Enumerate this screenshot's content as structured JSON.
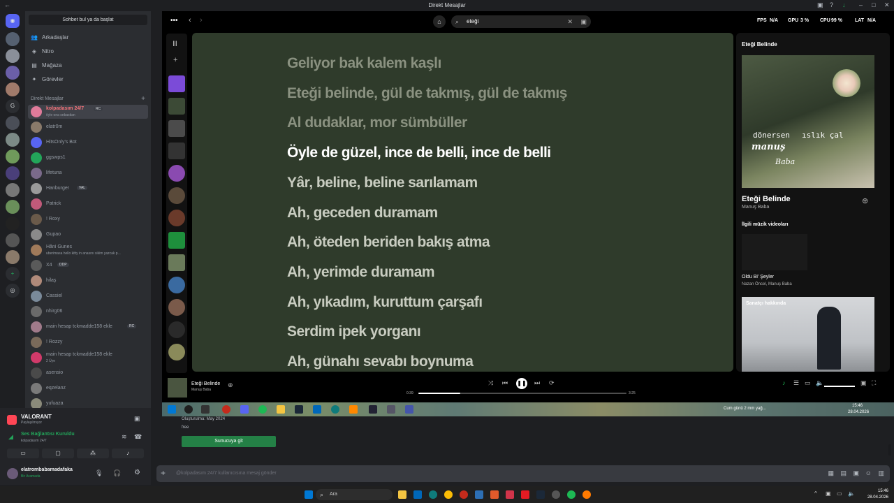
{
  "window": {
    "title": "Direkt Mesajlar"
  },
  "rail": {
    "letter": "G"
  },
  "sidebar": {
    "search_button": "Sohbet bul ya da başlat",
    "nav": [
      "Arkadaşlar",
      "Nitro",
      "Mağaza",
      "Görevler"
    ],
    "dm_header": "Direkt Mesajlar",
    "dms": [
      {
        "name": "kolpadasım 24/7",
        "sub": "öyle ona sebastian",
        "badge": "RC"
      },
      {
        "name": "elatr0m",
        "sub": "",
        "badge": ""
      },
      {
        "name": "HitsOnly's Bot",
        "sub": "",
        "badge": ""
      },
      {
        "name": "ggswps1",
        "sub": "",
        "badge": ""
      },
      {
        "name": "lifetuna",
        "sub": "",
        "badge": ""
      },
      {
        "name": "Hanburger",
        "sub": "",
        "badge": "VAL"
      },
      {
        "name": "Patrick",
        "sub": "",
        "badge": ""
      },
      {
        "name": "! Roxy",
        "sub": "",
        "badge": ""
      },
      {
        "name": "Gupao",
        "sub": "",
        "badge": ""
      },
      {
        "name": "Hâni Gunes",
        "sub": "uberimasa hello kitty in anasını sikim yazcak p...",
        "badge": ""
      },
      {
        "name": "X4",
        "sub": "",
        "badge": "DDP"
      },
      {
        "name": "hilaş",
        "sub": "",
        "badge": ""
      },
      {
        "name": "Cassiel",
        "sub": "",
        "badge": ""
      },
      {
        "name": "nhirg06",
        "sub": "",
        "badge": ""
      },
      {
        "name": "main hesap tckmadde158 ekle",
        "sub": "",
        "badge": "RC"
      },
      {
        "name": "! Rozzy",
        "sub": "",
        "badge": ""
      },
      {
        "name": "main hesap tckmadde158 ekle",
        "sub": "2 Üye",
        "badge": ""
      },
      {
        "name": "asensio",
        "sub": "",
        "badge": ""
      },
      {
        "name": "eqzelanz",
        "sub": "",
        "badge": ""
      },
      {
        "name": "yufuaza",
        "sub": "",
        "badge": ""
      }
    ]
  },
  "userpanel": {
    "activity_title": "VALORANT",
    "activity_sub": "Paylaşılmıyor",
    "voice_status": "Ses Bağlantısı Kuruldu",
    "voice_channel": "kolpadasım 24/7",
    "username": "elatrombabamadafaka",
    "user_status": "Bir Aramada"
  },
  "spotify": {
    "search_value": "eteği",
    "hud": {
      "fps_label": "FPS",
      "fps_val": "N/A",
      "gpu_label": "GPU",
      "gpu_val": "3 %",
      "cpu_label": "CPU",
      "cpu_val": "99 %",
      "lat_label": "LAT",
      "lat_val": "N/A"
    },
    "lyrics": [
      {
        "text": "Geliyor bak kalem kaşlı",
        "state": "past"
      },
      {
        "text": "Eteği belinde, gül de takmış, gül de takmış",
        "state": "past"
      },
      {
        "text": "Al dudaklar, mor sümbüller",
        "state": "past"
      },
      {
        "text": "Öyle de güzel, ince de belli, ince de belli",
        "state": "cur"
      },
      {
        "text": "Yâr, beline, beline sarılamam",
        "state": "future"
      },
      {
        "text": "Ah, geceden duramam",
        "state": "future"
      },
      {
        "text": "Ah, öteden beriden bakış atma",
        "state": "future"
      },
      {
        "text": "Ah, yerimde duramam",
        "state": "future"
      },
      {
        "text": "Ah, yıkadım, kuruttum çarşafı",
        "state": "future"
      },
      {
        "text": "Serdim ipek yorganı",
        "state": "future"
      },
      {
        "text": "Ah, günahı sevabı boynuma",
        "state": "future"
      }
    ],
    "nowplaying": {
      "header": "Eteği Belinde",
      "cover_line1": "dönersen",
      "cover_line2": "ıslık çal",
      "cover_line3": "manuş",
      "cover_line4": "Baba",
      "song": "Eteği Belinde",
      "artist": "Manuş Baba",
      "related_header": "İlgili müzik videoları",
      "video_title": "Oldu Bi' Şeyler",
      "video_artists": "Nazan Öncel, Manuş Baba",
      "about_label": "Sanatçı hakkında"
    },
    "player": {
      "title": "Eteği Belinde",
      "artist": "Manuş Baba",
      "elapsed": "0:39",
      "total": "3:25",
      "progress": 0.2
    }
  },
  "innerbar": {
    "weather": "Cum günü 2 mm yağ...",
    "time": "15:46",
    "date": "28.04.2026"
  },
  "servercard": {
    "created": "Oluşturulma: May 2024",
    "desc": "free",
    "join_button": "Sunucuya git"
  },
  "message": {
    "placeholder": "@kolpadasım 24/7 kullanıcısına mesaj gönder"
  },
  "taskbar": {
    "search": "Ara",
    "time": "15:46",
    "date": "28.04.2026"
  }
}
